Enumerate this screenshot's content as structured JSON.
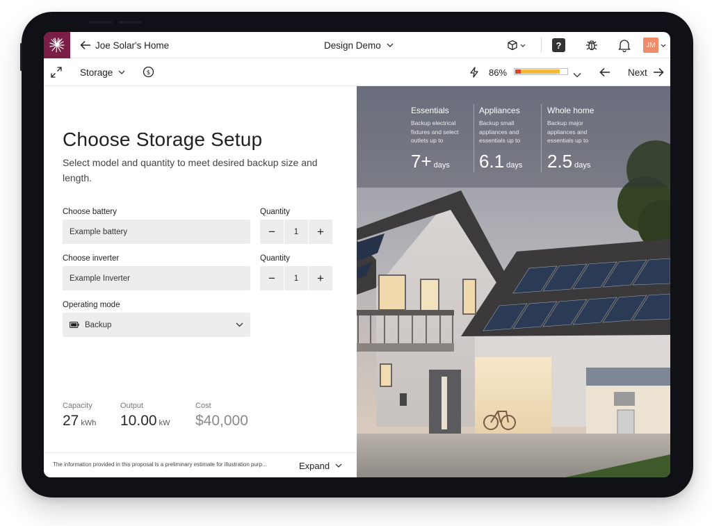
{
  "topbar": {
    "back_label": "Joe Solar's Home",
    "project_name": "Design Demo",
    "help_label": "?",
    "avatar_initials": "JM"
  },
  "subbar": {
    "section_label": "Storage",
    "progress_percent_label": "86%",
    "progress_fraction": 0.86,
    "next_label": "Next"
  },
  "page": {
    "title": "Choose Storage Setup",
    "subtitle": "Select model and quantity to meet desired backup size and length."
  },
  "form": {
    "battery_label": "Choose battery",
    "battery_value": "Example battery",
    "battery_qty_label": "Quantity",
    "battery_qty": "1",
    "inverter_label": "Choose inverter",
    "inverter_value": "Example Inverter",
    "inverter_qty_label": "Quantity",
    "inverter_qty": "1",
    "mode_label": "Operating mode",
    "mode_value": "Backup",
    "minus": "−",
    "plus": "+"
  },
  "stats": {
    "capacity_label": "Capacity",
    "capacity_value": "27",
    "capacity_unit": "kWh",
    "output_label": "Output",
    "output_value": "10.00",
    "output_unit": "kW",
    "cost_label": "Cost",
    "cost_value": "$40,000"
  },
  "footer": {
    "disclaimer": "The information provided in this proposal is a preliminary estimate for illustration purp...",
    "expand_label": "Expand"
  },
  "backup": [
    {
      "title": "Essentials",
      "desc": "Backup electrical fixtures and select outlets up to",
      "value": "7+",
      "unit": "days"
    },
    {
      "title": "Appliances",
      "desc": "Backup small appliances and essentials up to",
      "value": "6.1",
      "unit": "days"
    },
    {
      "title": "Whole home",
      "desc": "Backup major appliances and essentials up to",
      "value": "2.5",
      "unit": "days"
    }
  ],
  "colors": {
    "brand": "#7b1e45",
    "progress_fill": "#f5b83d",
    "progress_accent": "#d4452c",
    "avatar": "#f08c6a"
  }
}
